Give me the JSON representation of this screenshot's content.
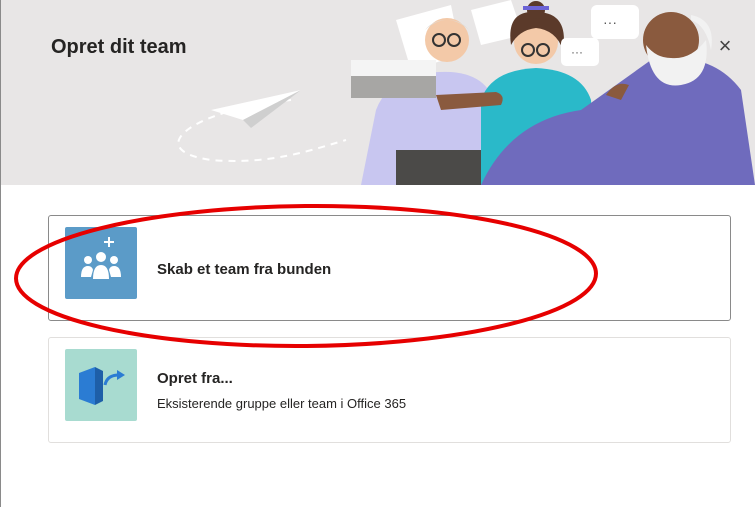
{
  "dialog": {
    "title": "Opret dit team",
    "close_label": "×"
  },
  "options": [
    {
      "title": "Skab et team fra bunden",
      "subtitle": "",
      "icon": "team-add-icon",
      "tile_color": "#5b9bc8"
    },
    {
      "title": "Opret fra...",
      "subtitle": "Eksisterende gruppe eller team i Office 365",
      "icon": "office-import-icon",
      "tile_color": "#a8dbd0"
    }
  ],
  "annotation": {
    "shape": "ellipse",
    "color": "#e60000"
  }
}
